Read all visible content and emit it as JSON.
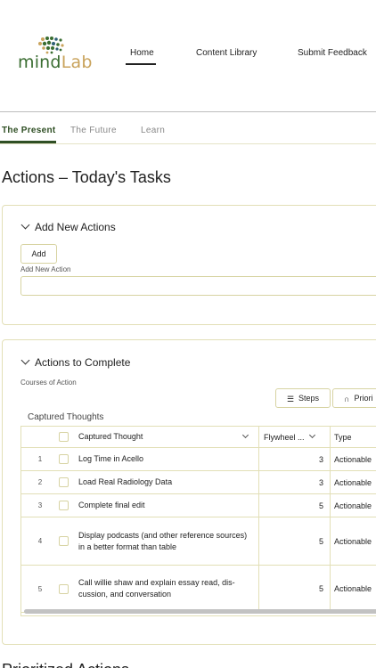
{
  "header": {
    "logo": {
      "mind": "mind",
      "lab": "Lab"
    },
    "nav": {
      "home": "Home",
      "content_library": "Content Library",
      "submit_feedback": "Submit Feedback"
    }
  },
  "tabs": {
    "present": "The Present",
    "future": "The Future",
    "learn": "Learn"
  },
  "page_title": "Actions – Today's Tasks",
  "add_section": {
    "title": "Add New Actions",
    "add_button": "Add",
    "field_label": "Add New Action",
    "input_value": ""
  },
  "complete_section": {
    "title": "Actions to Complete",
    "subtitle": "Courses of Action",
    "steps_button": "Steps",
    "priority_button": "Priori",
    "table_label": "Captured Thoughts",
    "columns": {
      "thought": "Captured Thought",
      "flywheel": "Flywheel ...",
      "type": "Type"
    },
    "rows": [
      {
        "num": "1",
        "thought": "Log Time in Acello",
        "flywheel": "3",
        "type": "Actionable"
      },
      {
        "num": "2",
        "thought": "Load Real Radiology Data",
        "flywheel": "3",
        "type": "Actionable"
      },
      {
        "num": "3",
        "thought": "Complete final edit",
        "flywheel": "5",
        "type": "Actionable"
      },
      {
        "num": "4",
        "thought": "Display podcasts (and other reference sources) in a better format than table",
        "flywheel": "5",
        "type": "Actionable"
      },
      {
        "num": "5",
        "thought": "Call willie shaw and explain essay read, dis-cussion, and conversation",
        "flywheel": "5",
        "type": "Actionable"
      }
    ]
  },
  "next_section_title": "Prioritized Actions",
  "colors": {
    "brand_green": "#3a6d31",
    "brand_gold": "#c9a35c",
    "accent_dark_green": "#2f4f24",
    "card_border": "#e2dfb6"
  }
}
